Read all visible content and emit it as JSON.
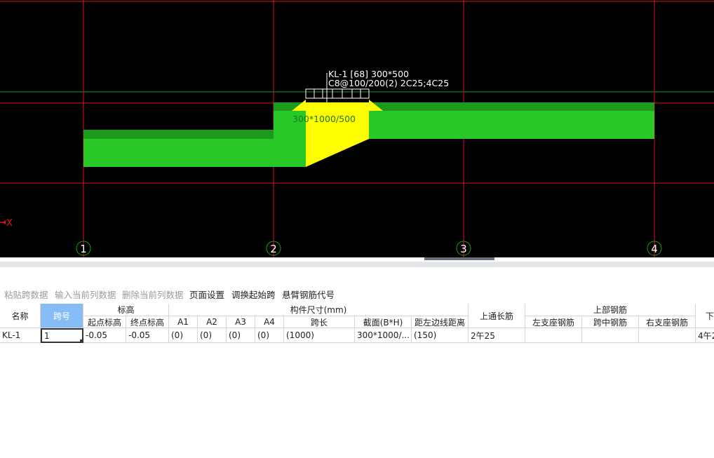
{
  "drawing": {
    "beam_label_line1": "KL-1 [68] 300*500",
    "beam_label_line2": "C8@100/200(2) 2C25;4C25",
    "haunch_label": "300*1000/500",
    "axis_markers": [
      "1",
      "2",
      "3",
      "4"
    ],
    "axis_x_label": "X",
    "colors": {
      "background": "#000000",
      "grid": "#e01414",
      "beam": "#28c828",
      "beam_top": "#1c9a1c",
      "haunch": "#ffff00",
      "axis_circle": "#1aa01a",
      "axis_text": "#ffffff"
    }
  },
  "toolbar": [
    {
      "label": "粘贴跨数据",
      "enabled": false
    },
    {
      "label": "输入当前列数据",
      "enabled": false
    },
    {
      "label": "删除当前列数据",
      "enabled": false
    },
    {
      "label": "页面设置",
      "enabled": true
    },
    {
      "label": "调换起始跨",
      "enabled": true
    },
    {
      "label": "悬臂钢筋代号",
      "enabled": true
    }
  ],
  "table": {
    "headers": {
      "name": "名称",
      "span_no": "跨号",
      "elevation": "标高",
      "start_elev": "起点标高",
      "end_elev": "终点标高",
      "dims": "构件尺寸(mm)",
      "a1": "A1",
      "a2": "A2",
      "a3": "A3",
      "a4": "A4",
      "span_len": "跨长",
      "section": "截面(B*H)",
      "left_dist": "距左边线距离",
      "top_long": "上通长筋",
      "top_steel": "上部钢筋",
      "left_support": "左支座钢筋",
      "mid_span": "跨中钢筋",
      "right_support": "右支座钢筋",
      "next_partial": "下"
    },
    "row": {
      "name": "KL-1",
      "span_no": "1",
      "start_elev": "-0.05",
      "end_elev": "-0.05",
      "a1": "(0)",
      "a2": "(0)",
      "a3": "(0)",
      "a4": "(0)",
      "span_len": "(1000)",
      "section": "300*1000/...",
      "left_dist": "(150)",
      "top_long": "2午25",
      "left_support": "",
      "mid_span": "",
      "right_support": "",
      "next_partial": "4午2"
    }
  }
}
